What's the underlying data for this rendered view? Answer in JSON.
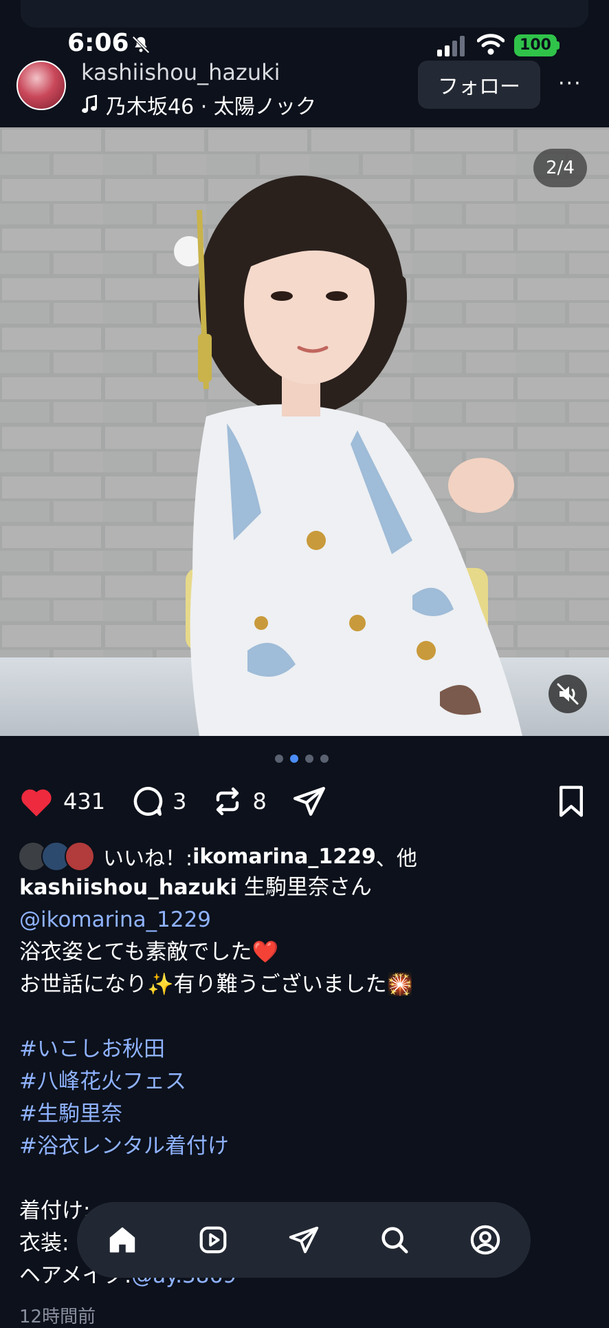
{
  "status_bar": {
    "time": "6:06",
    "battery": "100"
  },
  "post_header": {
    "username": "kashiishou_hazuki",
    "music": "乃木坂46 · 太陽ノック",
    "follow_label": "フォロー",
    "more_label": "···"
  },
  "media": {
    "counter": "2/4",
    "dots_total": 4,
    "dots_active_index": 2
  },
  "actions": {
    "likes": "431",
    "comments": "3",
    "reposts": "8"
  },
  "likes_line": {
    "prefix": "いいね！: ",
    "user": "ikomarina_1229",
    "suffix": "、他"
  },
  "caption": {
    "author": "kashiishou_hazuki",
    "first_text": " 生駒里奈さん",
    "mention": "@ikomarina_1229",
    "line3": "浴衣姿とても素敵でした❤️",
    "line4": "お世話になり✨有り難うございました🎇",
    "hashtags": [
      "#いこしお秋田",
      "#八峰花火フェス",
      "#生駒里奈",
      "#浴衣レンタル着付け"
    ],
    "line_kitsuke": "着付け:",
    "line_isho": "衣装:",
    "line_hair_prefix": "ヘアメイク:",
    "line_hair_mention": "@ay.3869"
  },
  "timestamp": "12時間前",
  "colors": {
    "background": "#0c111b",
    "like_red": "#ee2a3e",
    "link_blue": "#8fb2ff",
    "battery_green": "#30c34a"
  },
  "icons": {
    "status": [
      "bell-slash-icon",
      "signal-icon",
      "wifi-icon"
    ],
    "actions": [
      "heart-icon",
      "comment-icon",
      "repost-icon",
      "share-icon",
      "bookmark-icon"
    ],
    "nav": [
      "home-icon",
      "video-icon",
      "send-icon",
      "search-icon",
      "profile-icon"
    ]
  }
}
